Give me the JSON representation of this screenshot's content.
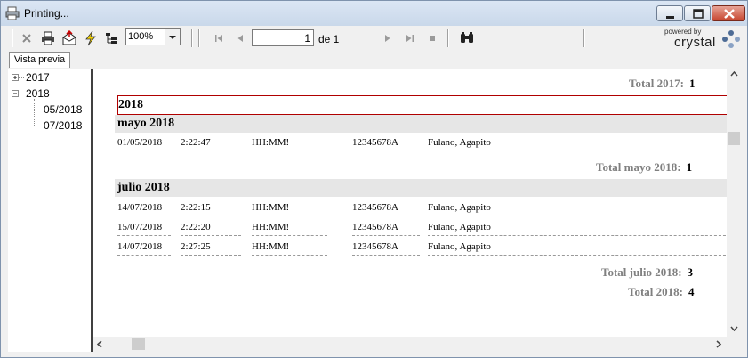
{
  "window": {
    "title": "Printing..."
  },
  "toolbar": {
    "zoom_value": "100%",
    "page_value": "1",
    "page_of": "de 1",
    "logo_top": "powered by",
    "logo_main": "crystal"
  },
  "tabs": [
    {
      "label": "Vista previa"
    }
  ],
  "tree": {
    "items": [
      {
        "label": "2017"
      },
      {
        "label": "2018"
      },
      {
        "label": "05/2018"
      },
      {
        "label": "07/2018"
      }
    ]
  },
  "report": {
    "total_2017_label": "Total  2017:",
    "total_2017_value": "1",
    "year_header": "2018",
    "group_mayo": "mayo 2018",
    "mayo_rows": [
      {
        "date": "01/05/2018",
        "time": "2:22:47",
        "hhmm": "HH:MM!",
        "id": "12345678A",
        "name": "Fulano, Agapito"
      }
    ],
    "total_mayo_label": "Total  mayo 2018:",
    "total_mayo_value": "1",
    "group_julio": "julio 2018",
    "julio_rows": [
      {
        "date": "14/07/2018",
        "time": "2:22:15",
        "hhmm": "HH:MM!",
        "id": "12345678A",
        "name": "Fulano, Agapito"
      },
      {
        "date": "15/07/2018",
        "time": "2:22:20",
        "hhmm": "HH:MM!",
        "id": "12345678A",
        "name": "Fulano, Agapito"
      },
      {
        "date": "14/07/2018",
        "time": "2:27:25",
        "hhmm": "HH:MM!",
        "id": "12345678A",
        "name": "Fulano, Agapito"
      }
    ],
    "total_julio_label": "Total  julio 2018:",
    "total_julio_value": "3",
    "total_2018_label": "Total  2018:",
    "total_2018_value": "4"
  },
  "colors": {
    "titlebar": "#c9d8ea",
    "year_border": "#b00000",
    "group_band": "#e6e6e6",
    "total_label": "#808080"
  }
}
